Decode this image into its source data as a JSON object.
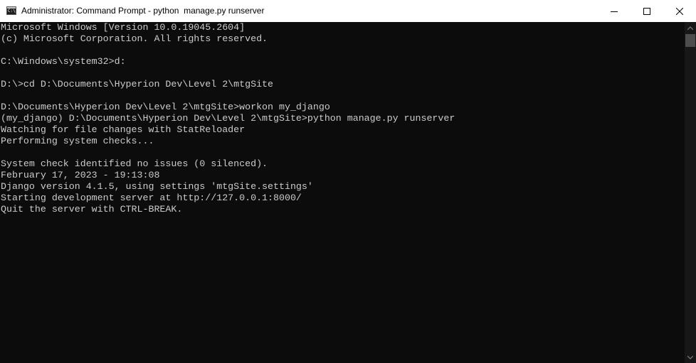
{
  "window": {
    "title": "Administrator: Command Prompt - python  manage.py runserver",
    "icon": "cmd-icon",
    "icon_text": "C:\\.",
    "buttons": {
      "minimize": "minimize-icon",
      "maximize": "maximize-icon",
      "close": "close-icon"
    }
  },
  "colors": {
    "background": "#0c0c0c",
    "text": "#cccccc",
    "titlebar": "#ffffff",
    "scrollbar_track": "#171717",
    "scrollbar_thumb": "#4d4d4d"
  },
  "terminal": {
    "lines": [
      "Microsoft Windows [Version 10.0.19045.2604]",
      "(c) Microsoft Corporation. All rights reserved.",
      "",
      "C:\\Windows\\system32>d:",
      "",
      "D:\\>cd D:\\Documents\\Hyperion Dev\\Level 2\\mtgSite",
      "",
      "D:\\Documents\\Hyperion Dev\\Level 2\\mtgSite>workon my_django",
      "(my_django) D:\\Documents\\Hyperion Dev\\Level 2\\mtgSite>python manage.py runserver",
      "Watching for file changes with StatReloader",
      "Performing system checks...",
      "",
      "System check identified no issues (0 silenced).",
      "February 17, 2023 - 19:13:08",
      "Django version 4.1.5, using settings 'mtgSite.settings'",
      "Starting development server at http://127.0.0.1:8000/",
      "Quit the server with CTRL-BREAK."
    ]
  }
}
